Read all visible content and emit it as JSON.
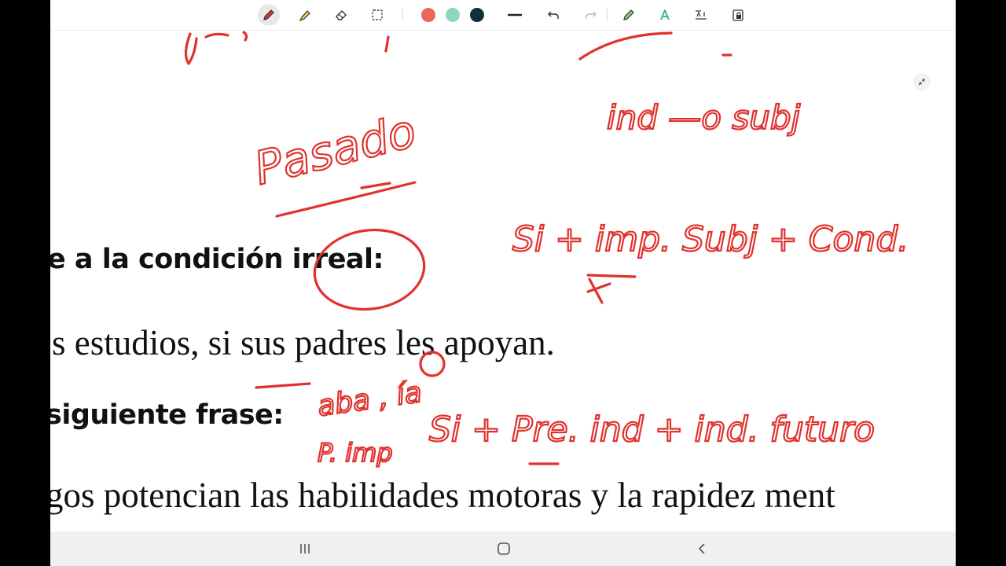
{
  "toolbar": {
    "tools": [
      {
        "name": "pen-tool",
        "icon": "pen-icon",
        "active": true
      },
      {
        "name": "highlighter-tool",
        "icon": "highlighter-icon"
      },
      {
        "name": "eraser-tool",
        "icon": "eraser-icon"
      },
      {
        "name": "lasso-select-tool",
        "icon": "lasso-select-icon"
      }
    ],
    "colors": [
      "#e8685c",
      "#8fd4c4",
      "#10303a"
    ],
    "actions": [
      "stroke-width-icon",
      "undo-icon",
      "redo-icon",
      "pen-settings-icon",
      "handwriting-to-text-icon",
      "text-to-speech-icon",
      "read-only-lock-icon"
    ]
  },
  "document": {
    "heading_1": "e a la condición irreal:",
    "sentence_1": "s estudios, si sus padres les apoyan.",
    "heading_2": "siguiente frase:",
    "sentence_2": "gos potencian las habilidades motoras y la rapidez ment"
  },
  "annotations": {
    "pasado": "Pasado",
    "ind_subj": "ind —o subj",
    "si_imp_subj": "Si + imp. Subj + Cond.",
    "aba_ia": "aba , ía",
    "p_imp": "P. imp",
    "si_pre_ind": "Si + Pre. ind + ind. futuro"
  },
  "colors": {
    "ink": "#e0322d",
    "navbar": "#f0f0f0",
    "letterbox": "#000000"
  },
  "navbar": {
    "buttons": [
      "recent-apps-icon",
      "home-icon",
      "back-icon"
    ]
  }
}
